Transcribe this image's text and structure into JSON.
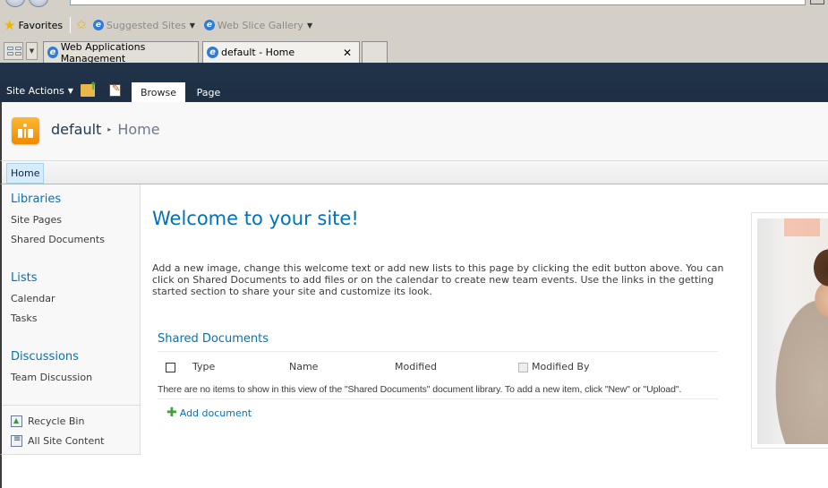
{
  "browser": {
    "favorites_bar": {
      "favorites_label": "Favorites",
      "items": [
        {
          "label": "Suggested Sites",
          "icon": "ie-icon"
        },
        {
          "label": "Web Slice Gallery",
          "icon": "ie-icon"
        }
      ]
    },
    "tabs": [
      {
        "label": "Web Applications Management",
        "active": false
      },
      {
        "label": "default - Home",
        "active": true,
        "close_glyph": "✕"
      }
    ]
  },
  "ribbon": {
    "site_actions_label": "Site Actions",
    "tabs": [
      {
        "label": "Browse",
        "active": true
      },
      {
        "label": "Page",
        "active": false
      }
    ]
  },
  "title_area": {
    "site_name": "default",
    "separator_glyph": "▸",
    "page_name": "Home"
  },
  "top_nav": {
    "items": [
      {
        "label": "Home",
        "selected": true
      }
    ]
  },
  "quick_launch": {
    "sections": [
      {
        "heading": "Libraries",
        "links": [
          "Site Pages",
          "Shared Documents"
        ]
      },
      {
        "heading": "Lists",
        "links": [
          "Calendar",
          "Tasks"
        ]
      },
      {
        "heading": "Discussions",
        "links": [
          "Team Discussion"
        ]
      }
    ],
    "bottom_links": [
      {
        "label": "Recycle Bin",
        "icon": "recycle-bin-icon"
      },
      {
        "label": "All Site Content",
        "icon": "all-site-content-icon"
      }
    ]
  },
  "main": {
    "welcome_title": "Welcome to your site!",
    "intro_text": "Add a new image, change this welcome text or add new lists to this page by clicking the edit button above. You can click on Shared Documents to add files or on the calendar to create new team events. Use the links in the getting started section to share your site and customize its look.",
    "shared_documents": {
      "title": "Shared Documents",
      "columns": [
        "Type",
        "Name",
        "Modified",
        "Modified By"
      ],
      "empty_message": "There are no items to show in this view of the \"Shared Documents\" document library. To add a new item, click \"New\" or \"Upload\".",
      "add_label": "Add document"
    }
  }
}
